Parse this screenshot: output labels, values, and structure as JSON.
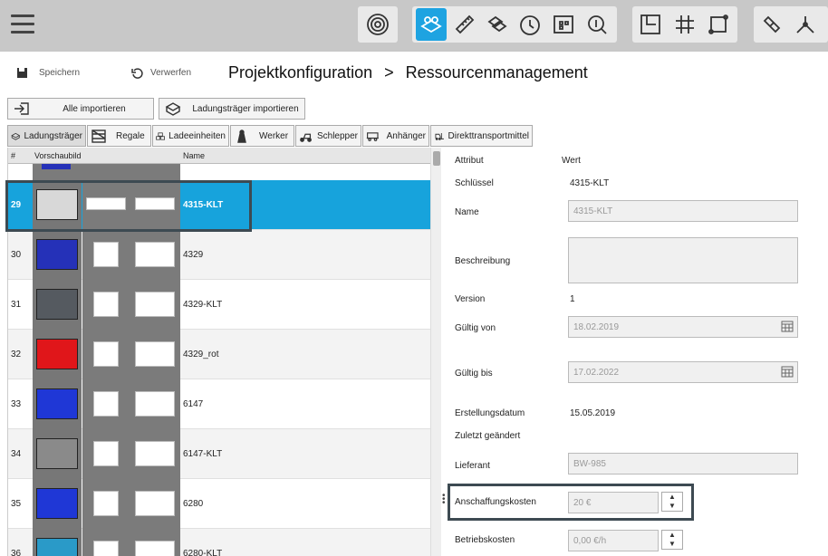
{
  "toolbar": {
    "menu_icon": "hamburger-menu-icon",
    "groups": [
      [
        "target-icon"
      ],
      [
        "sites-icon",
        "ruler-icon",
        "boxes-icon",
        "clock-icon",
        "layout-grid-icon",
        "search-cost-icon"
      ],
      [
        "floorplan-icon",
        "grid-icon",
        "route-icon"
      ],
      [
        "link-icon",
        "fork-icon"
      ]
    ],
    "active_icon": "sites-icon",
    "accent": "#1ea3e1"
  },
  "actions": {
    "save_label": "Speichern",
    "discard_label": "Verwerfen"
  },
  "breadcrumb": {
    "part1": "Projektkonfiguration",
    "separator": ">",
    "part2": "Ressourcenmanagement"
  },
  "import_buttons": {
    "all_label": "Alle importieren",
    "carriers_label": "Ladungsträger importieren"
  },
  "tabs": [
    "Ladungsträger",
    "Regale",
    "Ladeeinheiten",
    "Werker",
    "Schlepper",
    "Anhänger",
    "Direkttransportmittel"
  ],
  "grid": {
    "headers": {
      "num": "#",
      "preview": "Vorschaubild",
      "name": "Name"
    },
    "rows": [
      {
        "num": "29",
        "name": "4315-KLT",
        "color": "#d8d8d8",
        "selected": true
      },
      {
        "num": "30",
        "name": "4329",
        "color": "#2531b8",
        "selected": false
      },
      {
        "num": "31",
        "name": "4329-KLT",
        "color": "#555a60",
        "selected": false
      },
      {
        "num": "32",
        "name": "4329_rot",
        "color": "#e0161a",
        "selected": false
      },
      {
        "num": "33",
        "name": "6147",
        "color": "#1f37d6",
        "selected": false
      },
      {
        "num": "34",
        "name": "6147-KLT",
        "color": "#8a8a8a",
        "selected": false
      },
      {
        "num": "35",
        "name": "6280",
        "color": "#1f37d6",
        "selected": false
      },
      {
        "num": "36",
        "name": "6280-KLT",
        "color": "#2a9ac8",
        "selected": false
      }
    ]
  },
  "props": {
    "head_attr": "Attribut",
    "head_val": "Wert",
    "key_label": "Schlüssel",
    "key_value": "4315-KLT",
    "name_label": "Name",
    "name_value": "4315-KLT",
    "desc_label": "Beschreibung",
    "version_label": "Version",
    "version_value": "1",
    "valid_from_label": "Gültig von",
    "valid_from_value": "18.02.2019",
    "valid_to_label": "Gültig bis",
    "valid_to_value": "17.02.2022",
    "created_label": "Erstellungsdatum",
    "created_value": "15.05.2019",
    "changed_label": "Zuletzt geändert",
    "supplier_label": "Lieferant",
    "supplier_value": "BW-985",
    "acq_label": "Anschaffungskosten",
    "acq_value": "20 €",
    "op_label": "Betriebskosten",
    "op_value": "0,00 €/h"
  }
}
